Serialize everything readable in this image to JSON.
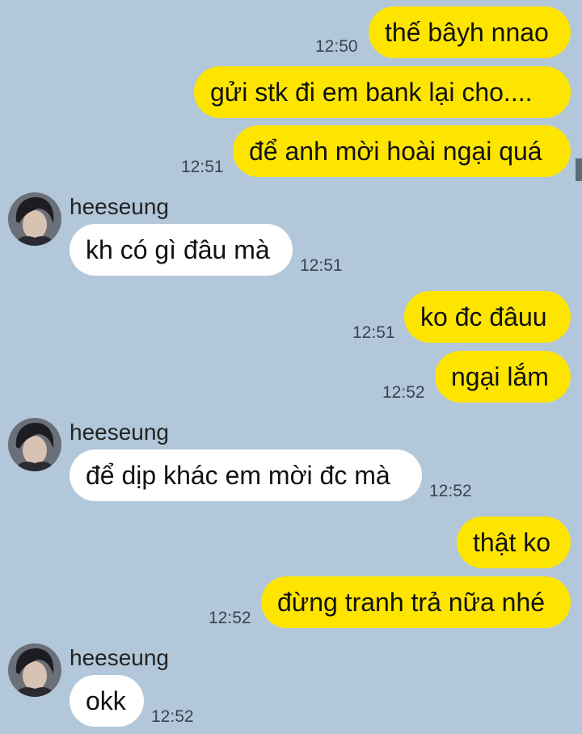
{
  "conversation": {
    "contact_name": "heeseung",
    "messages": [
      {
        "text": "thế bâyh nnao",
        "time": "12:50"
      },
      {
        "text": "gửi stk đi em bank lại cho...."
      },
      {
        "text": "để anh mời hoài ngại quá",
        "time": "12:51"
      },
      {
        "sender": "heeseung",
        "text": "kh có gì đâu mà",
        "time": "12:51"
      },
      {
        "text": "ko đc đâuu",
        "time": "12:51"
      },
      {
        "text": "ngại lắm",
        "time": "12:52"
      },
      {
        "sender": "heeseung",
        "text": "để dịp khác em mời đc mà",
        "time": "12:52"
      },
      {
        "text": "thật ko"
      },
      {
        "text": "đừng tranh trả nữa nhé",
        "time": "12:52"
      },
      {
        "sender": "heeseung",
        "text": "okk",
        "time": "12:52"
      }
    ]
  },
  "colors": {
    "background": "#b2c7d9",
    "outgoing_bubble": "#fee500",
    "incoming_bubble": "#ffffff"
  },
  "icons": {
    "avatar": "profile-photo"
  }
}
